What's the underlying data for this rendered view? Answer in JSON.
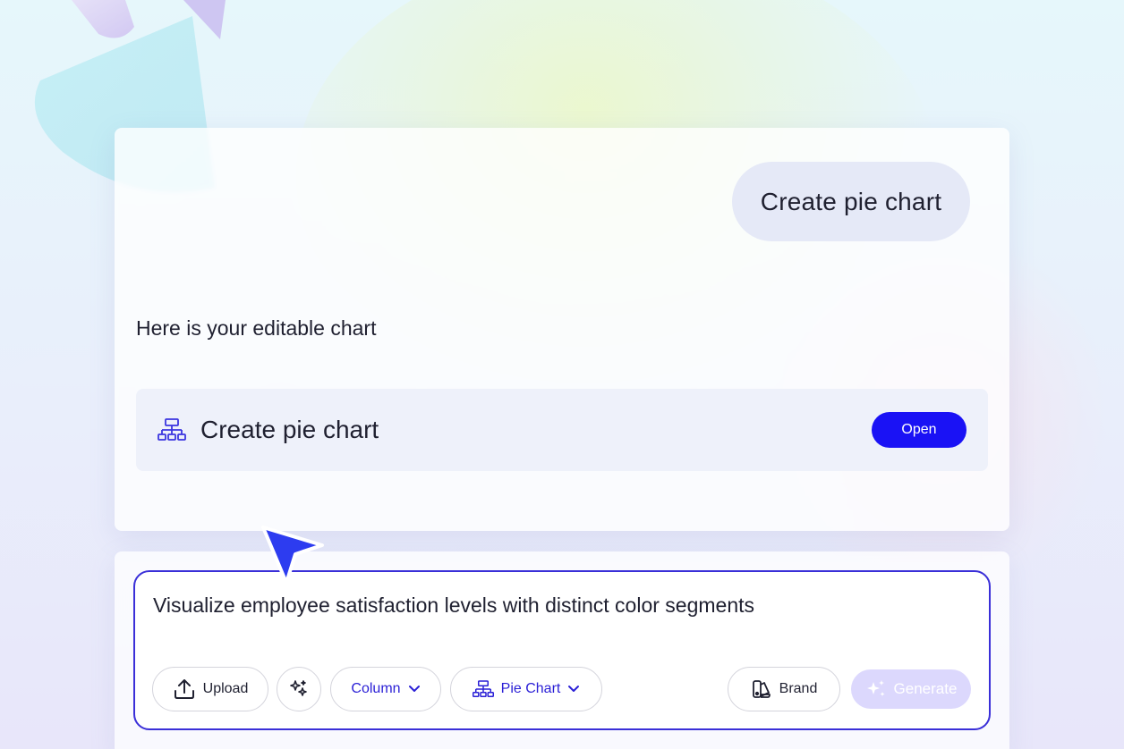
{
  "chat": {
    "user_message": "Create pie chart",
    "assistant_reply": "Here is your editable chart",
    "result_card": {
      "title": "Create pie chart",
      "icon": "hierarchy-chart-icon",
      "open_label": "Open"
    }
  },
  "prompt": {
    "text": "Visualize employee satisfaction levels with distinct color segments"
  },
  "toolbar": {
    "upload_label": "Upload",
    "magic_icon": "sparkle-wand-icon",
    "column_label": "Column",
    "pie_chart_label": "Pie Chart",
    "brand_label": "Brand",
    "generate_label": "Generate"
  },
  "colors": {
    "accent": "#1a12f5",
    "prompt_border": "#3a2fd8",
    "generate_disabled": "#dcd8fd",
    "bubble": "#e5e9f7"
  }
}
